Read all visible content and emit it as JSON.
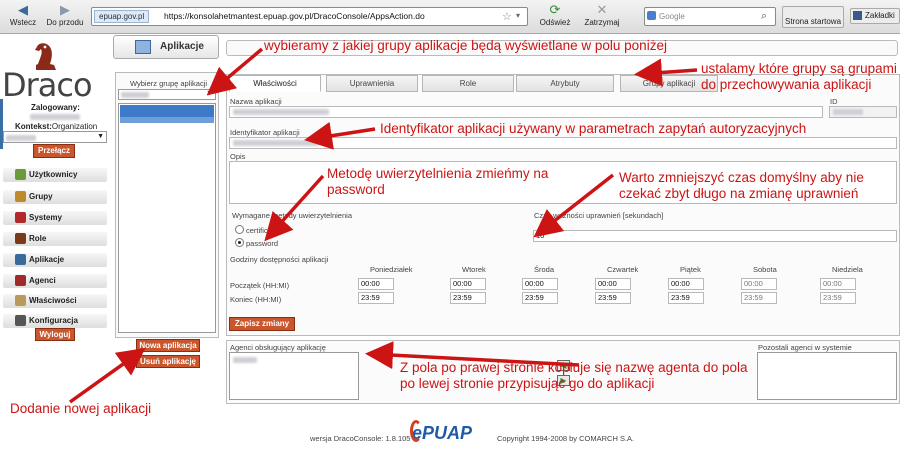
{
  "browser": {
    "back_label": "Wstecz",
    "forward_label": "Do przodu",
    "site_badge": "epuap.gov.pl",
    "url": "https://konsolahetmantest.epuap.gov.pl/DracoConsole/AppsAction.do",
    "refresh_label": "Odśwież",
    "stop_label": "Zatrzymaj",
    "search_placeholder": "Google",
    "home_label": "Strona startowa",
    "bookmarks_label": "Zakładki"
  },
  "sidebar": {
    "logo": "Draco",
    "logged_label": "Zalogowany:",
    "context_label": "Kontekst:",
    "context_value": "Organization",
    "switch_button": "Przełącz",
    "items": [
      {
        "label": "Użytkownicy",
        "icon": "users-icon",
        "color": "#6a9a3a"
      },
      {
        "label": "Grupy",
        "icon": "groups-icon",
        "color": "#c08a2a"
      },
      {
        "label": "Systemy",
        "icon": "systems-icon",
        "color": "#b02a2a"
      },
      {
        "label": "Role",
        "icon": "role-icon",
        "color": "#7a3a1a"
      },
      {
        "label": "Aplikacje",
        "icon": "applications-icon",
        "color": "#3a6a9b"
      },
      {
        "label": "Agenci",
        "icon": "agents-icon",
        "color": "#a02a2a"
      },
      {
        "label": "Właściwości",
        "icon": "properties-icon",
        "color": "#b89a5a"
      },
      {
        "label": "Konfiguracja",
        "icon": "configuration-icon",
        "color": "#555555"
      }
    ],
    "logout_button": "Wyloguj"
  },
  "header": {
    "title": "Aplikacje"
  },
  "group_panel": {
    "label": "Wybierz grupę aplikacji",
    "new_button": "Nowa aplikacja",
    "delete_button": "Usuń aplikację"
  },
  "tabs": [
    "Właściwości",
    "Uprawnienia",
    "Role",
    "Atrybuty",
    "Grupy aplikacji"
  ],
  "form": {
    "name_label": "Nazwa aplikacji",
    "id_label": "ID",
    "identifier_label": "Identyfikator aplikacji",
    "description_label": "Opis",
    "auth_label": "Wymagane metody uwierzytelnienia",
    "auth_options": [
      "certificate",
      "password"
    ],
    "auth_selected": "password",
    "time_label": "Czas ważności uprawnień [sekundach]",
    "time_value": "10",
    "hours_label": "Godziny dostępności aplikacji",
    "days": [
      "Poniedziałek",
      "Wtorek",
      "Środa",
      "Czwartek",
      "Piątek",
      "Sobota",
      "Niedziela"
    ],
    "start_label": "Początek (HH:MI)",
    "end_label": "Koniec (HH:MI)",
    "start_values": [
      "00:00",
      "00:00",
      "00:00",
      "00:00",
      "00:00",
      "00:00",
      "00:00"
    ],
    "end_values": [
      "23:59",
      "23:59",
      "23:59",
      "23:59",
      "23:59",
      "23:59",
      "23:59"
    ],
    "save_button": "Zapisz zmiany",
    "agents_label": "Agenci obsługujący aplikację",
    "other_agents_label": "Pozostali agenci w systemie"
  },
  "footer": {
    "version": "wersja DracoConsole: 1.8.105",
    "logo": "ePUAP",
    "copyright": "Copyright 1994-2008 by COMARCH S.A."
  },
  "annotations": {
    "group_select": "wybieramy z jakiej grupy aplikacje będą wyświetlane w polu poniżej",
    "groups_tab": "ustalamy które grupy są grupami do przechowywania aplikacji",
    "identifier": "Identyfikator aplikacji używany w parametrach zapytań autoryzacyjnych",
    "auth_method": "Metodę uwierzytelnienia zmieńmy na password",
    "time": "Warto zmniejszyć czas domyślny aby nie czekać zbyt długo na zmianę uprawnień",
    "agents": "Z pola po prawej stronie kopiuje się nazwę agenta do pola po lewej stronie przypisując go do aplikacji",
    "new_app": "Dodanie nowej aplikacji"
  }
}
